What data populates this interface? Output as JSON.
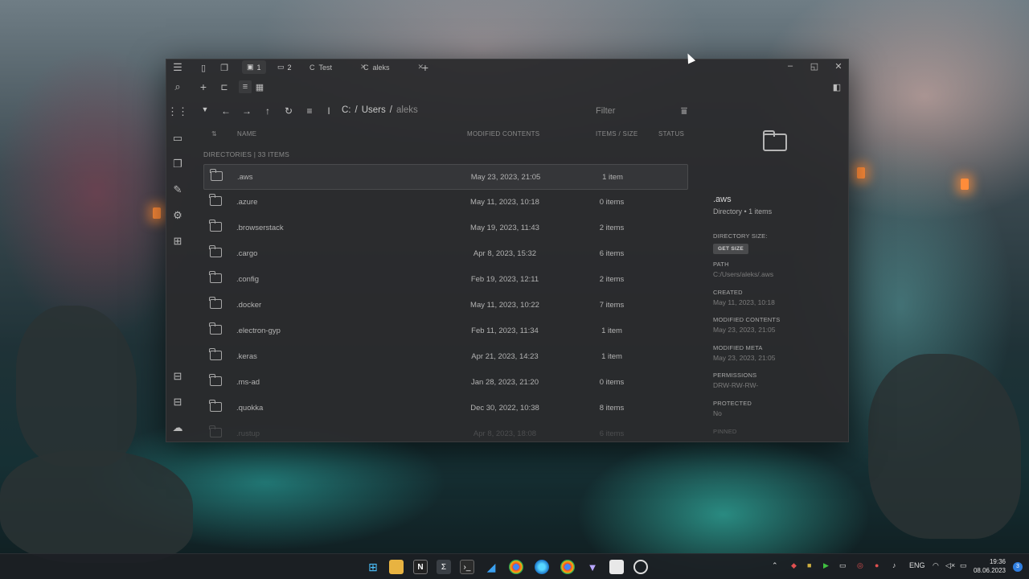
{
  "window": {
    "workspace_tabs": [
      {
        "label": "1"
      },
      {
        "label": "2"
      }
    ],
    "tabs": [
      {
        "icon_letter": "C",
        "label": "Test"
      },
      {
        "icon_letter": "C",
        "label": "aleks"
      }
    ],
    "new_tab": "+",
    "add_button": "+"
  },
  "navigation": {
    "path": [
      "C:",
      "Users",
      "aleks"
    ],
    "separator": "/",
    "filter_placeholder": "Filter"
  },
  "columns": {
    "name": "NAME",
    "modified": "MODIFIED CONTENTS",
    "items_size": "ITEMS / SIZE",
    "status": "STATUS"
  },
  "section_label": "DIRECTORIES | 33 ITEMS",
  "rows": [
    {
      "name": ".aws",
      "modified": "May 23, 2023, 21:05",
      "items": "1 item"
    },
    {
      "name": ".azure",
      "modified": "May 11, 2023, 10:18",
      "items": "0 items"
    },
    {
      "name": ".browserstack",
      "modified": "May 19, 2023, 11:43",
      "items": "2 items"
    },
    {
      "name": ".cargo",
      "modified": "Apr 8, 2023, 15:32",
      "items": "6 items"
    },
    {
      "name": ".config",
      "modified": "Feb 19, 2023, 12:11",
      "items": "2 items"
    },
    {
      "name": ".docker",
      "modified": "May 11, 2023, 10:22",
      "items": "7 items"
    },
    {
      "name": ".electron-gyp",
      "modified": "Feb 11, 2023, 11:34",
      "items": "1 item"
    },
    {
      "name": ".keras",
      "modified": "Apr 21, 2023, 14:23",
      "items": "1 item"
    },
    {
      "name": ".ms-ad",
      "modified": "Jan 28, 2023, 21:20",
      "items": "0 items"
    },
    {
      "name": ".quokka",
      "modified": "Dec 30, 2022, 10:38",
      "items": "8 items"
    },
    {
      "name": ".rustup",
      "modified": "Apr 8, 2023, 18:08",
      "items": "6 items"
    }
  ],
  "details": {
    "title": ".aws",
    "subtitle": "Directory • 1 items",
    "dir_size_label": "DIRECTORY SIZE:",
    "get_size_button": "GET SIZE",
    "path_label": "PATH",
    "path_value": "C:/Users/aleks/.aws",
    "created_label": "CREATED",
    "created_value": "May 11, 2023, 10:18",
    "modified_contents_label": "MODIFIED CONTENTS",
    "modified_contents_value": "May 23, 2023, 21:05",
    "modified_meta_label": "MODIFIED META",
    "modified_meta_value": "May 23, 2023, 21:05",
    "permissions_label": "PERMISSIONS",
    "permissions_value": "DRW-RW-RW-",
    "protected_label": "PROTECTED",
    "protected_value": "No",
    "pinned_label": "PINNED"
  },
  "taskbar": {
    "language": "ENG",
    "time": "19:36",
    "date": "08.06.2023",
    "notification_count": "3"
  }
}
